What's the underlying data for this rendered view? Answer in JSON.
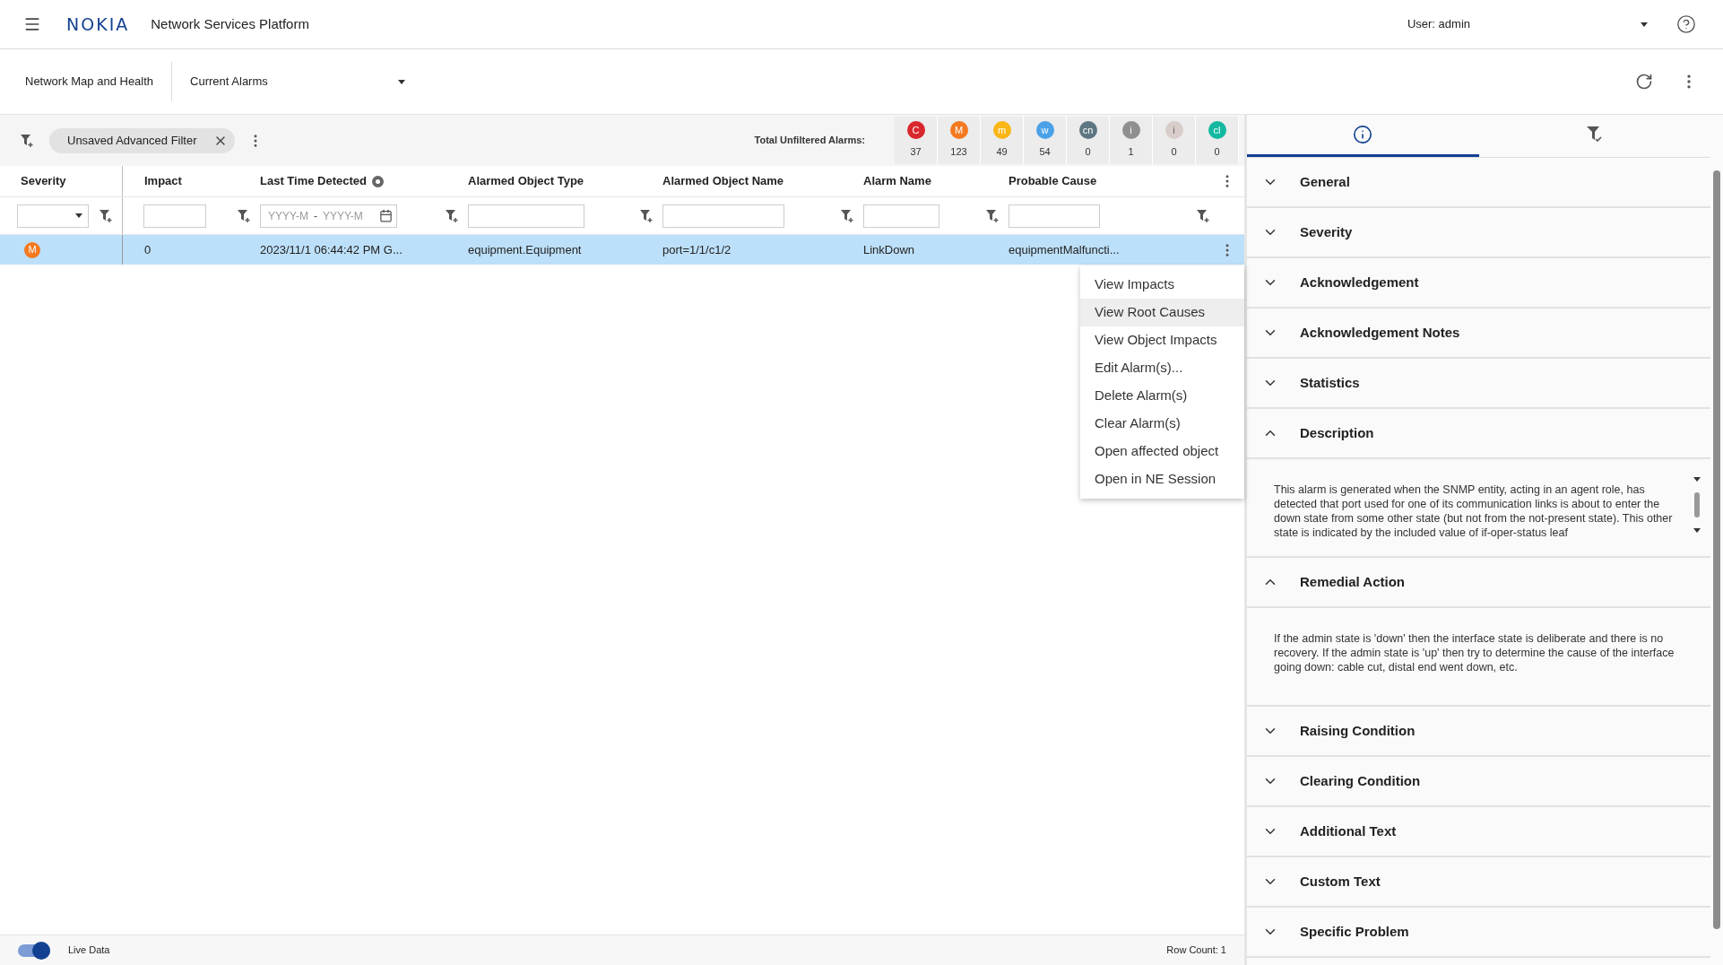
{
  "header": {
    "logo": "NOKIA",
    "app_title": "Network Services Platform",
    "user_label": "User: admin"
  },
  "subheader": {
    "parent_view": "Network Map and Health",
    "view_select": "Current Alarms"
  },
  "toolbar": {
    "filter_chip": "Unsaved Advanced Filter",
    "total_label": "Total Unfiltered Alarms:",
    "counters": [
      {
        "letter": "C",
        "count": "37",
        "color": "#d9262e"
      },
      {
        "letter": "M",
        "count": "123",
        "color": "#f47920"
      },
      {
        "letter": "m",
        "count": "49",
        "color": "#f9b617"
      },
      {
        "letter": "w",
        "count": "54",
        "color": "#4ba1e8"
      },
      {
        "letter": "cn",
        "count": "0",
        "color": "#5e7682"
      },
      {
        "letter": "i",
        "count": "1",
        "color": "#8f8f8f"
      },
      {
        "letter": "i",
        "count": "0",
        "color": "#d8cdca"
      },
      {
        "letter": "cl",
        "count": "0",
        "color": "#12b9a0"
      }
    ]
  },
  "table": {
    "columns": [
      {
        "label": "Severity",
        "kind": "select",
        "sort_indicator": false
      },
      {
        "label": "Impact",
        "kind": "text",
        "sort_indicator": false
      },
      {
        "label": "Last Time Detected",
        "kind": "date",
        "sort_indicator": true,
        "placeholder_from": "YYYY-M",
        "date_separator": "-",
        "placeholder_to": "YYYY-M"
      },
      {
        "label": "Alarmed Object Type",
        "kind": "text",
        "sort_indicator": false
      },
      {
        "label": "Alarmed Object Name",
        "kind": "text",
        "sort_indicator": false
      },
      {
        "label": "Alarm Name",
        "kind": "text",
        "sort_indicator": false
      },
      {
        "label": "Probable Cause",
        "kind": "text",
        "sort_indicator": false
      }
    ],
    "rows": [
      {
        "selected": true,
        "cells": [
          {
            "kind": "severity",
            "text": "M",
            "color": "#f47920"
          },
          {
            "kind": "text",
            "text": "0"
          },
          {
            "kind": "text",
            "text": "2023/11/1 06:44:42 PM G..."
          },
          {
            "kind": "text",
            "text": "equipment.Equipment"
          },
          {
            "kind": "text",
            "text": "port=1/1/c1/2"
          },
          {
            "kind": "text",
            "text": "LinkDown"
          },
          {
            "kind": "text",
            "text": "equipmentMalfuncti..."
          }
        ]
      }
    ]
  },
  "context_menu": {
    "items": [
      {
        "label": "View Impacts",
        "selected": false
      },
      {
        "label": "View Root Causes",
        "selected": true
      },
      {
        "label": "View Object Impacts",
        "selected": false
      },
      {
        "label": "Edit Alarm(s)...",
        "selected": false
      },
      {
        "label": "Delete Alarm(s)",
        "selected": false
      },
      {
        "label": "Clear Alarm(s)",
        "selected": false
      },
      {
        "label": "Open affected object",
        "selected": false
      },
      {
        "label": "Open in NE Session",
        "selected": false
      }
    ]
  },
  "detail_panel": {
    "tabs": [
      {
        "kind": "info",
        "selected": true
      },
      {
        "kind": "filter-check",
        "selected": false
      }
    ],
    "sections": [
      {
        "title": "General",
        "expanded": false
      },
      {
        "title": "Severity",
        "expanded": false
      },
      {
        "title": "Acknowledgement",
        "expanded": false
      },
      {
        "title": "Acknowledgement Notes",
        "expanded": false
      },
      {
        "title": "Statistics",
        "expanded": false
      },
      {
        "title": "Description",
        "expanded": true,
        "body": "This alarm is generated when the SNMP entity, acting in an agent role, has detected that port used for one of its communication links is about to enter the down state from some other state (but not from the not-present state). This other state is indicated by the included value of if-oper-status leaf"
      },
      {
        "title": "Remedial Action",
        "expanded": true,
        "body": "If the admin state is 'down' then the interface state is deliberate and there is no recovery. If the admin state is 'up' then try to determine the cause of the interface going down: cable cut, distal end went down, etc."
      },
      {
        "title": "Raising Condition",
        "expanded": false
      },
      {
        "title": "Clearing Condition",
        "expanded": false
      },
      {
        "title": "Additional Text",
        "expanded": false
      },
      {
        "title": "Custom Text",
        "expanded": false
      },
      {
        "title": "Specific Problem",
        "expanded": false
      }
    ]
  },
  "footer": {
    "live_data": {
      "label": "Live Data",
      "on": true
    },
    "row_count": "Row Count: 1"
  }
}
